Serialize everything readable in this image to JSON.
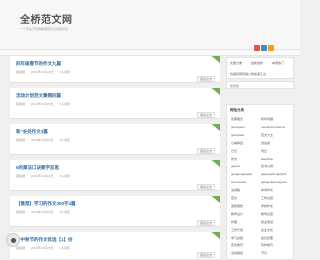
{
  "header": {
    "site_title": "全桥范文网",
    "subtitle": "一个专注于优秀精选范文分享的平台"
  },
  "social_icons": [
    {
      "name": "weibo-icon",
      "color": "#e05244"
    },
    {
      "name": "qq-icon",
      "color": "#3d8ccf"
    },
    {
      "name": "rss-icon",
      "color": "#f39c12"
    }
  ],
  "posts": [
    {
      "title": "四年级春节的作文九篇",
      "author": "容俗网",
      "date": "2023年01月22日",
      "views": "1人浏览",
      "more": "阅读全文"
    },
    {
      "title": "活动计划范文集锦四篇",
      "author": "容俗网",
      "date": "2023年01月20日",
      "views": "1人浏览",
      "more": "阅读全文"
    },
    {
      "title": "和“长处作文3篇",
      "author": "容俗网",
      "date": "2023年01月23日",
      "views": "1人浏览",
      "more": "阅读全文"
    },
    {
      "title": "5的乘法口诀教学反思",
      "author": "容俗网",
      "date": "2023年01月24日",
      "views": "1人浏览",
      "more": "阅读全文"
    },
    {
      "title": "【推荐】学习的作文300字4篇",
      "author": "容俗网",
      "date": "2023年01月25日",
      "views": "1人浏览",
      "more": "阅读全文"
    },
    {
      "title": "于中秋节的作文优选【1】份",
      "author": "容俗网",
      "date": "2023年01月25日",
      "views": "1人浏览",
      "more": "阅读全文"
    }
  ],
  "sidebar": {
    "tabs": [
      "文章分类",
      "最新发布",
      "本周热门"
    ],
    "tab_text": "抗美援朝英雄人物故事汇总",
    "search_label": "搜索框",
    "tags_title": "网站分类",
    "tags": [
      [
        "优美散文",
        "新年祝福"
      ],
      [
        "gsncopect",
        "memanzsmzwonu"
      ],
      [
        "guanrlaoll",
        "范文大全"
      ],
      [
        "心得体会",
        "读后感"
      ],
      [
        "日记",
        "周记"
      ],
      [
        "作文",
        "dianchou"
      ],
      [
        "gegmu",
        "读书心得"
      ],
      [
        "gexgeongkagrlo",
        "gegongzhengzigrhi"
      ],
      [
        "wenxumkai",
        "gebgenkeyvelgoxer"
      ],
      [
        "演讲稿",
        "中考作文"
      ],
      [
        "范文",
        "工作总结"
      ],
      [
        "述职报告",
        "学校作文"
      ],
      [
        "教学设计",
        "教学反思"
      ],
      [
        "护理",
        "职业规划"
      ],
      [
        "工作计划",
        "企业文化"
      ],
      [
        "学习总结",
        "会议纪要"
      ],
      [
        "安全教育",
        "写作技巧"
      ],
      [
        "活动策划",
        "节日"
      ]
    ]
  }
}
